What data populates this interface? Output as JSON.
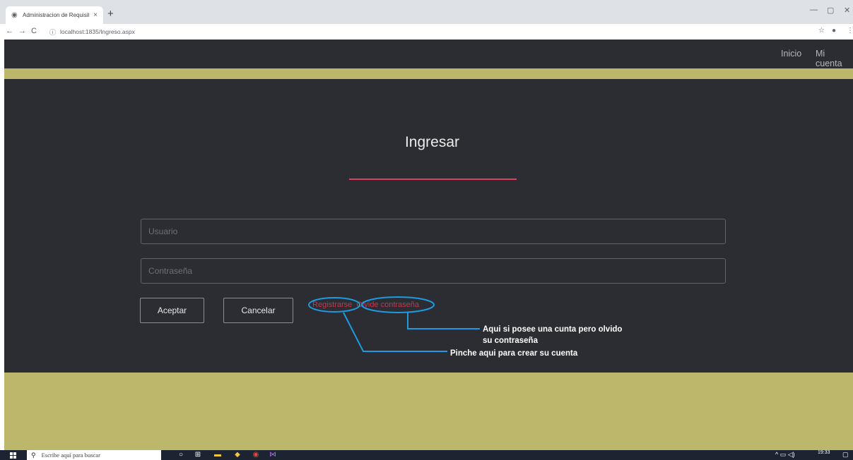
{
  "browser": {
    "tab_title": "Administracion de Requisitos",
    "tab_close": "×",
    "new_tab": "+",
    "url": "localhost:1835/Ingreso.aspx"
  },
  "nav": {
    "inicio": "Inicio",
    "mi_cuenta": "Mi cuenta"
  },
  "login": {
    "title": "Ingresar",
    "usuario_placeholder": "Usuario",
    "contrasena_placeholder": "Contraseña",
    "aceptar": "Aceptar",
    "cancelar": "Cancelar",
    "registrarse": "Registrarse",
    "separator": "o",
    "olvide": "Olvide contraseña"
  },
  "annotations": {
    "olvide_line1": "Aqui si posee una cunta pero olvido",
    "olvide_line2": "su contraseña",
    "registrarse": "Pinche aqui para crear su cuenta"
  },
  "taskbar": {
    "search_placeholder": "Escribe aquí para buscar",
    "time": "19:33"
  },
  "colors": {
    "dark_bg": "#2c2c33",
    "olive": "#bdb76b",
    "accent_red": "#e0405f",
    "annotation_blue": "#1e9be0"
  }
}
